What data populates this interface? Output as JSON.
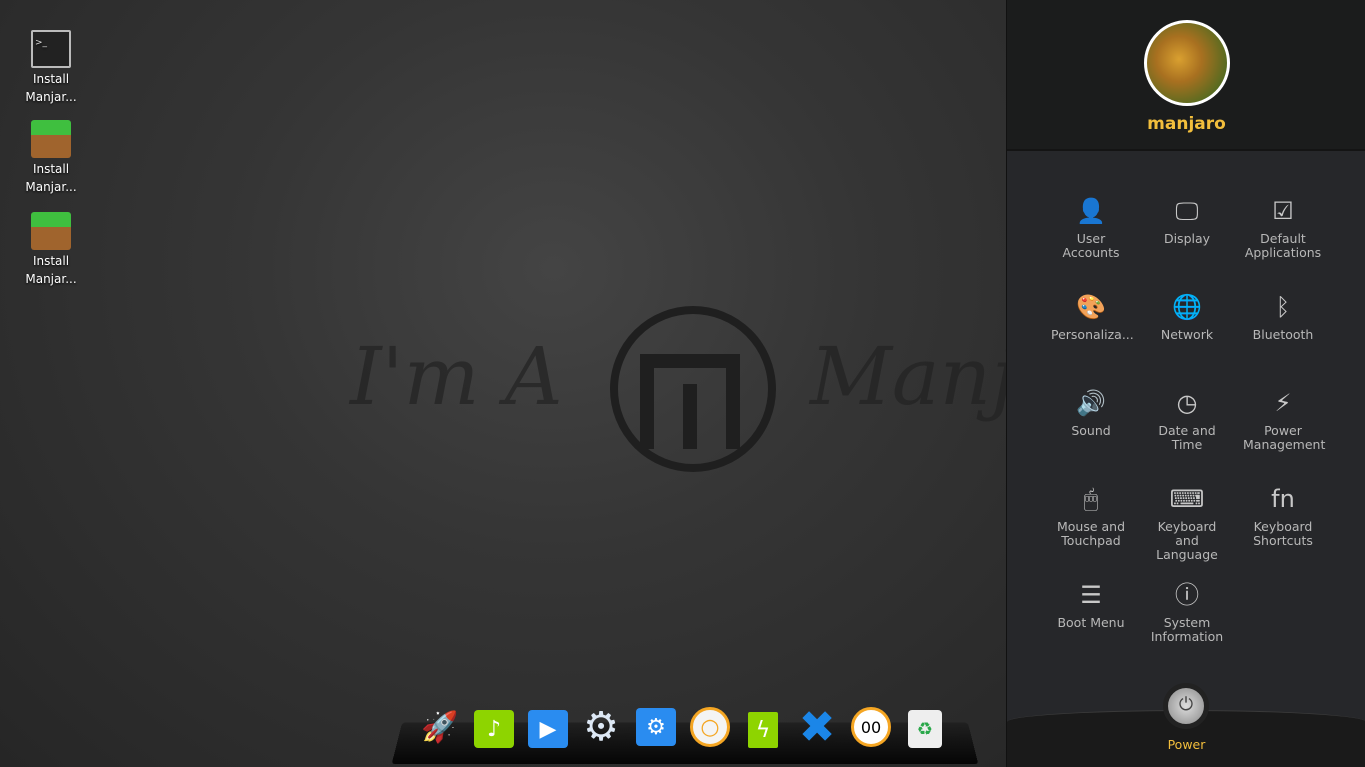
{
  "desktop": {
    "icons": [
      {
        "label": "Install Manjar...",
        "icon": "terminal-icon"
      },
      {
        "label": "Install Manjar...",
        "icon": "package-icon"
      },
      {
        "label": "Install Manjar...",
        "icon": "package-icon"
      }
    ],
    "wallpaper_text_left": "I'm A",
    "wallpaper_text_right": "Manja"
  },
  "dock": {
    "items": [
      {
        "name": "launcher",
        "icon": "rocket-icon",
        "color": "#e0202a"
      },
      {
        "name": "music",
        "icon": "music-icon",
        "color": "#8ed400"
      },
      {
        "name": "video",
        "icon": "video-icon",
        "color": "#2a8cf0"
      },
      {
        "name": "settings",
        "icon": "gear-icon",
        "color": "#ffffff"
      },
      {
        "name": "deepin-settings",
        "icon": "control-center-icon",
        "color": "#2a8cf0"
      },
      {
        "name": "volume",
        "icon": "volume-knob-icon",
        "color": "#f5a623"
      },
      {
        "name": "power",
        "icon": "battery-icon",
        "color": "#8ed400"
      },
      {
        "name": "browser",
        "icon": "browser-icon",
        "color": "#1b86e8"
      },
      {
        "name": "clock",
        "icon": "clock-icon",
        "color": "#f5a623",
        "text": "00"
      },
      {
        "name": "trash",
        "icon": "trash-icon",
        "color": "#eeeeee"
      }
    ]
  },
  "panel": {
    "username": "manjaro",
    "accent": "#f2be3c",
    "items": [
      {
        "label": "User Accounts",
        "icon": "user-icon",
        "glyph": "👤"
      },
      {
        "label": "Display",
        "icon": "monitor-icon",
        "glyph": "🖵"
      },
      {
        "label": "Default Applications",
        "icon": "default-apps-icon",
        "glyph": "☑"
      },
      {
        "label": "Personaliza...",
        "icon": "palette-icon",
        "glyph": "🎨"
      },
      {
        "label": "Network",
        "icon": "globe-icon",
        "glyph": "🌐"
      },
      {
        "label": "Bluetooth",
        "icon": "bluetooth-icon",
        "glyph": "ᛒ"
      },
      {
        "label": "Sound",
        "icon": "speaker-icon",
        "glyph": "🔊"
      },
      {
        "label": "Date and Time",
        "icon": "clock-icon",
        "glyph": "◷"
      },
      {
        "label": "Power Management",
        "icon": "battery-icon",
        "glyph": "⚡"
      },
      {
        "label": "Mouse and Touchpad",
        "icon": "mouse-icon",
        "glyph": "🖱"
      },
      {
        "label": "Keyboard and Language",
        "icon": "keyboard-icon",
        "glyph": "⌨"
      },
      {
        "label": "Keyboard Shortcuts",
        "icon": "fn-key-icon",
        "glyph": "fn"
      },
      {
        "label": "Boot Menu",
        "icon": "boot-menu-icon",
        "glyph": "☰"
      },
      {
        "label": "System Information",
        "icon": "info-icon",
        "glyph": "ⓘ"
      }
    ],
    "power_label": "Power"
  }
}
